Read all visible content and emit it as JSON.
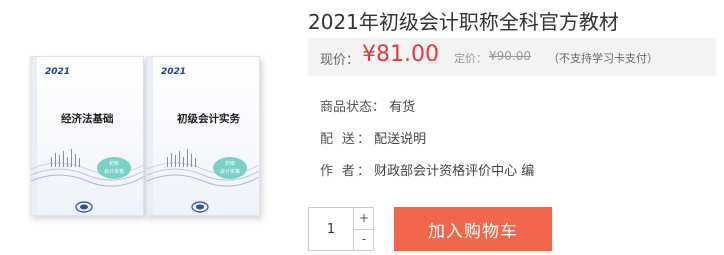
{
  "product": {
    "title": "2021年初级会计职称全科官方教材"
  },
  "price": {
    "current_label": "现价：",
    "current_value": "¥81.00",
    "list_label": "定价：",
    "list_value": "¥90.00",
    "note": "（不支持学习卡支付）"
  },
  "info": {
    "status_label": "商品状态：",
    "status_value": "有货",
    "delivery_label": "配 送：",
    "delivery_value": "配送说明",
    "author_label": "作 者：",
    "author_value": "财政部会计资格评价中心 编"
  },
  "quantity": {
    "value": "1",
    "plus": "+",
    "minus": "-"
  },
  "cart_button": "加入购物车",
  "books": [
    {
      "year": "2021",
      "title": "经济法基础",
      "badge_line1": "初级",
      "badge_line2": "会计资格"
    },
    {
      "year": "2021",
      "title": "初级会计实务",
      "badge_line1": "初级",
      "badge_line2": "会计资格"
    }
  ]
}
